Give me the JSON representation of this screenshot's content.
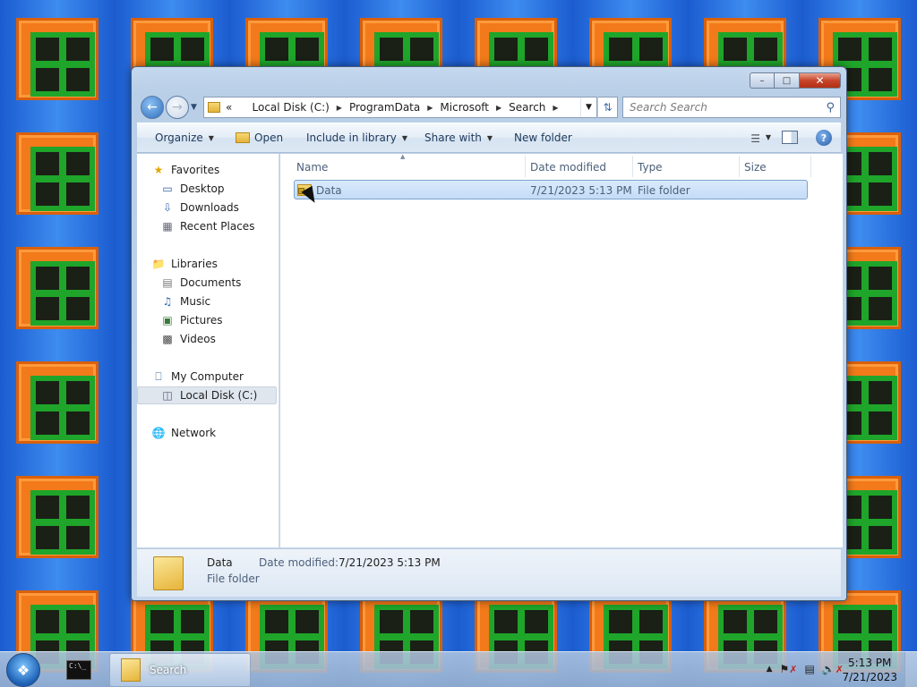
{
  "window": {
    "caption_min": "–",
    "caption_max": "□",
    "caption_close": "✕"
  },
  "address": {
    "prefix": "«",
    "crumbs": [
      "Local Disk (C:)",
      "ProgramData",
      "Microsoft",
      "Search"
    ],
    "separator": "▶"
  },
  "search": {
    "placeholder": "Search Search"
  },
  "toolbar": {
    "organize": "Organize",
    "open": "Open",
    "include_in_library": "Include in library",
    "share_with": "Share with",
    "new_folder": "New folder",
    "help": "?"
  },
  "sidebar": {
    "favorites": "Favorites",
    "desktop": "Desktop",
    "downloads": "Downloads",
    "recent_places": "Recent Places",
    "libraries": "Libraries",
    "documents": "Documents",
    "music": "Music",
    "pictures": "Pictures",
    "videos": "Videos",
    "my_computer": "My Computer",
    "local_disk": "Local Disk (C:)",
    "network": "Network"
  },
  "columns": [
    "Name",
    "Date modified",
    "Type",
    "Size"
  ],
  "files": [
    {
      "name": "Data",
      "date_modified": "7/21/2023 5:13 PM",
      "type": "File folder",
      "size": ""
    }
  ],
  "details": {
    "name": "Data",
    "type": "File folder",
    "modified_label": "Date modified:",
    "modified_value": "7/21/2023 5:13 PM"
  },
  "taskbar": {
    "cmd_label": "C:\\_",
    "explorer_label": "Search",
    "time": "5:13 PM",
    "date": "7/21/2023"
  },
  "icons": {
    "back": "back-arrow-icon",
    "forward": "forward-arrow-icon",
    "search": "magnifier-icon",
    "folder": "folder-icon"
  },
  "colors": {
    "selection": "#c4dcf7",
    "window_frame": "#c4d8ee",
    "accent": "#1e395b"
  }
}
